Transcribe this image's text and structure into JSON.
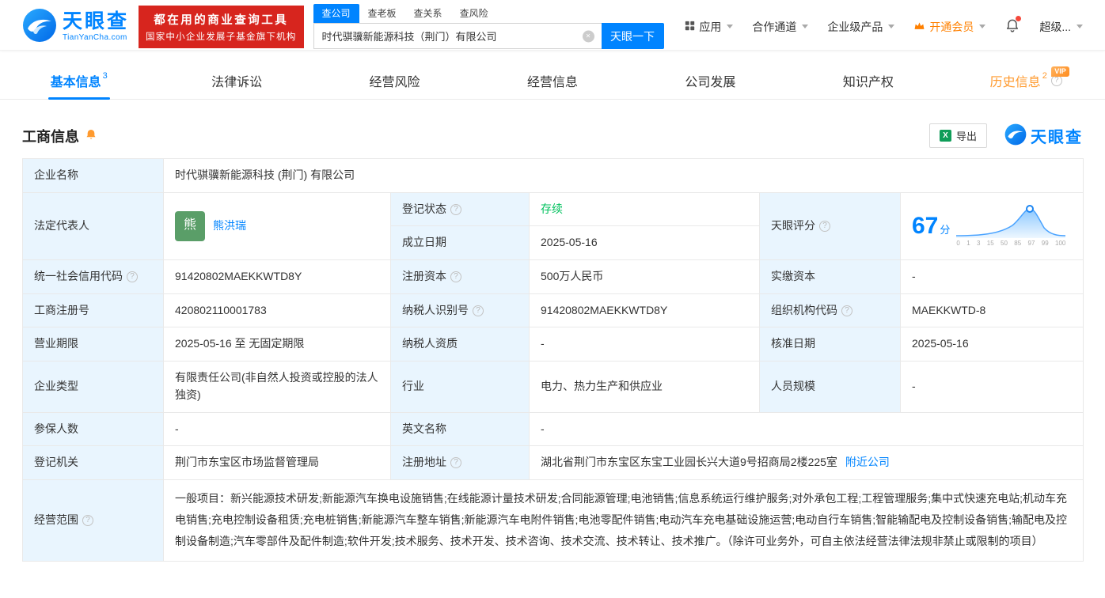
{
  "colors": {
    "brand_blue": "#0084ff",
    "promo_red": "#d7251e",
    "status_green": "#00c15d",
    "vip_orange": "#ff9a2e",
    "label_cell_bg": "#e9f5fe"
  },
  "icons": {
    "logo": "tianyancha-wave-icon",
    "apps": "grid-icon",
    "vip": "crown-icon",
    "notification": "bell-icon",
    "subscribe": "bell-icon",
    "export": "excel-icon",
    "help": "question-circle-icon",
    "clear": "clear-circle-icon"
  },
  "header": {
    "brand": "天眼查",
    "brand_domain": "TianYanCha.com",
    "promo_line1": "都在用的商业查询工具",
    "promo_line2": "国家中小企业发展子基金旗下机构",
    "search_tabs": [
      {
        "label": "查公司"
      },
      {
        "label": "查老板"
      },
      {
        "label": "查关系"
      },
      {
        "label": "查风险"
      }
    ],
    "search_value": "时代骐骥新能源科技（荆门）有限公司",
    "search_button": "天眼一下",
    "nav_app": "应用",
    "nav_partner": "合作通道",
    "nav_enterprise": "企业级产品",
    "nav_vip": "开通会员",
    "nav_user": "超级..."
  },
  "tabbar": [
    {
      "label": "基本信息",
      "badge": "3"
    },
    {
      "label": "法律诉讼"
    },
    {
      "label": "经营风险"
    },
    {
      "label": "经营信息"
    },
    {
      "label": "公司发展"
    },
    {
      "label": "知识产权"
    },
    {
      "label": "历史信息",
      "badge": "2",
      "vip": "VIP"
    }
  ],
  "section": {
    "title": "工商信息",
    "export_label": "导出",
    "brand": "天眼查"
  },
  "info": {
    "company_name": {
      "label": "企业名称",
      "value": "时代骐骥新能源科技 (荆门) 有限公司"
    },
    "legal_rep": {
      "label": "法定代表人",
      "avatar": "熊",
      "value": "熊洪瑞"
    },
    "reg_status": {
      "label": "登记状态",
      "value": "存续"
    },
    "est_date": {
      "label": "成立日期",
      "value": "2025-05-16"
    },
    "score": {
      "label": "天眼评分",
      "value": "67",
      "unit": "分"
    },
    "credit_code": {
      "label": "统一社会信用代码",
      "value": "91420802MAEKKWTD8Y"
    },
    "reg_capital": {
      "label": "注册资本",
      "value": "500万人民币"
    },
    "paid_capital": {
      "label": "实缴资本",
      "value": "-"
    },
    "reg_no": {
      "label": "工商注册号",
      "value": "420802110001783"
    },
    "taxpayer_no": {
      "label": "纳税人识别号",
      "value": "91420802MAEKKWTD8Y"
    },
    "org_code": {
      "label": "组织机构代码",
      "value": "MAEKKWTD-8"
    },
    "term": {
      "label": "营业期限",
      "value": "2025-05-16 至 无固定期限"
    },
    "taxpayer_quality": {
      "label": "纳税人资质",
      "value": "-"
    },
    "approve_date": {
      "label": "核准日期",
      "value": "2025-05-16"
    },
    "company_type": {
      "label": "企业类型",
      "value": "有限责任公司(非自然人投资或控股的法人独资)"
    },
    "industry": {
      "label": "行业",
      "value": "电力、热力生产和供应业"
    },
    "staff_size": {
      "label": "人员规模",
      "value": "-"
    },
    "insured": {
      "label": "参保人数",
      "value": "-"
    },
    "english_name": {
      "label": "英文名称",
      "value": "-"
    },
    "authority": {
      "label": "登记机关",
      "value": "荆门市东宝区市场监督管理局"
    },
    "address": {
      "label": "注册地址",
      "value": "湖北省荆门市东宝区东宝工业园长兴大道9号招商局2楼225室",
      "link": "附近公司"
    },
    "scope": {
      "label": "经营范围",
      "value": "一般项目：新兴能源技术研发;新能源汽车换电设施销售;在线能源计量技术研发;合同能源管理;电池销售;信息系统运行维护服务;对外承包工程;工程管理服务;集中式快速充电站;机动车充电销售;充电控制设备租赁;充电桩销售;新能源汽车整车销售;新能源汽车电附件销售;电池零配件销售;电动汽车充电基础设施运营;电动自行车销售;智能输配电及控制设备销售;输配电及控制设备制造;汽车零部件及配件制造;软件开发;技术服务、技术开发、技术咨询、技术交流、技术转让、技术推广。（除许可业务外，可自主依法经营法律法规非禁止或限制的项目）"
    }
  },
  "score_axis": [
    "0",
    "1",
    "3",
    "15",
    "50",
    "85",
    "97",
    "99",
    "100"
  ]
}
